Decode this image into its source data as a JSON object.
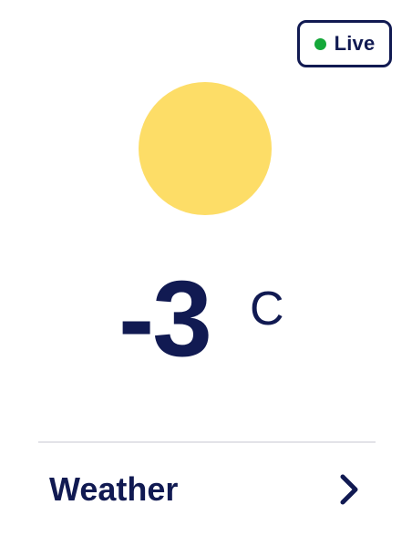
{
  "status": {
    "label": "Live",
    "dot_color": "#15a83a"
  },
  "weather": {
    "icon": "sun-icon",
    "icon_color": "#fddd67",
    "temperature": "-3",
    "unit": "C"
  },
  "footer": {
    "label": "Weather",
    "action_icon": "chevron-right-icon"
  },
  "colors": {
    "text": "#111a52",
    "divider": "#e3e3e8",
    "background": "#ffffff"
  }
}
